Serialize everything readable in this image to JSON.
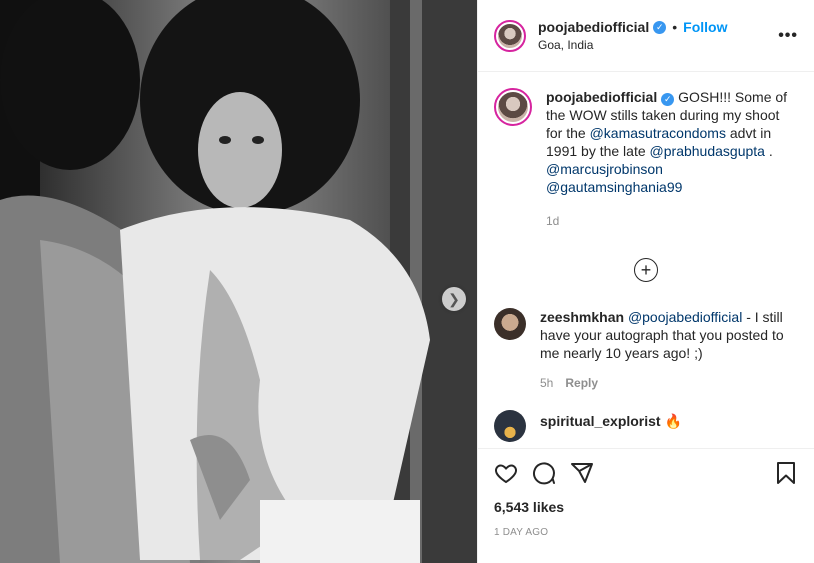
{
  "post": {
    "username": "poojabediofficial",
    "follow_label": "Follow",
    "location": "Goa, India",
    "more_label": "•••"
  },
  "caption": {
    "username": "poojabediofficial",
    "text_1": " GOSH!!! Some of the WOW stills taken during my shoot for the ",
    "mention_1": "@kamasutracondoms",
    "text_2": " advt in 1991 by the late ",
    "mention_2": "@prabhudasgupta",
    "text_3": " . ",
    "mention_3": "@marcusjrobinson",
    "mention_4": "@gautamsinghania99",
    "time": "1d"
  },
  "comments": [
    {
      "username": "zeeshmkhan",
      "mention": "@poojabediofficial",
      "text": " - I still have your autograph that you posted to me nearly 10 years ago! ;)",
      "time": "5h",
      "reply_label": "Reply"
    },
    {
      "username": "spiritual_explorist",
      "emoji": "🔥"
    }
  ],
  "footer": {
    "likes": "6,543 likes",
    "date": "1 DAY AGO"
  },
  "icons": {
    "like": "heart-icon",
    "comment": "comment-icon",
    "share": "paper-plane-icon",
    "save": "bookmark-icon",
    "next": "chevron-right-icon",
    "load_more": "plus-circle-icon"
  },
  "colors": {
    "accent": "#0095f6",
    "verified": "#3897f0",
    "muted": "#8e8e8e"
  }
}
